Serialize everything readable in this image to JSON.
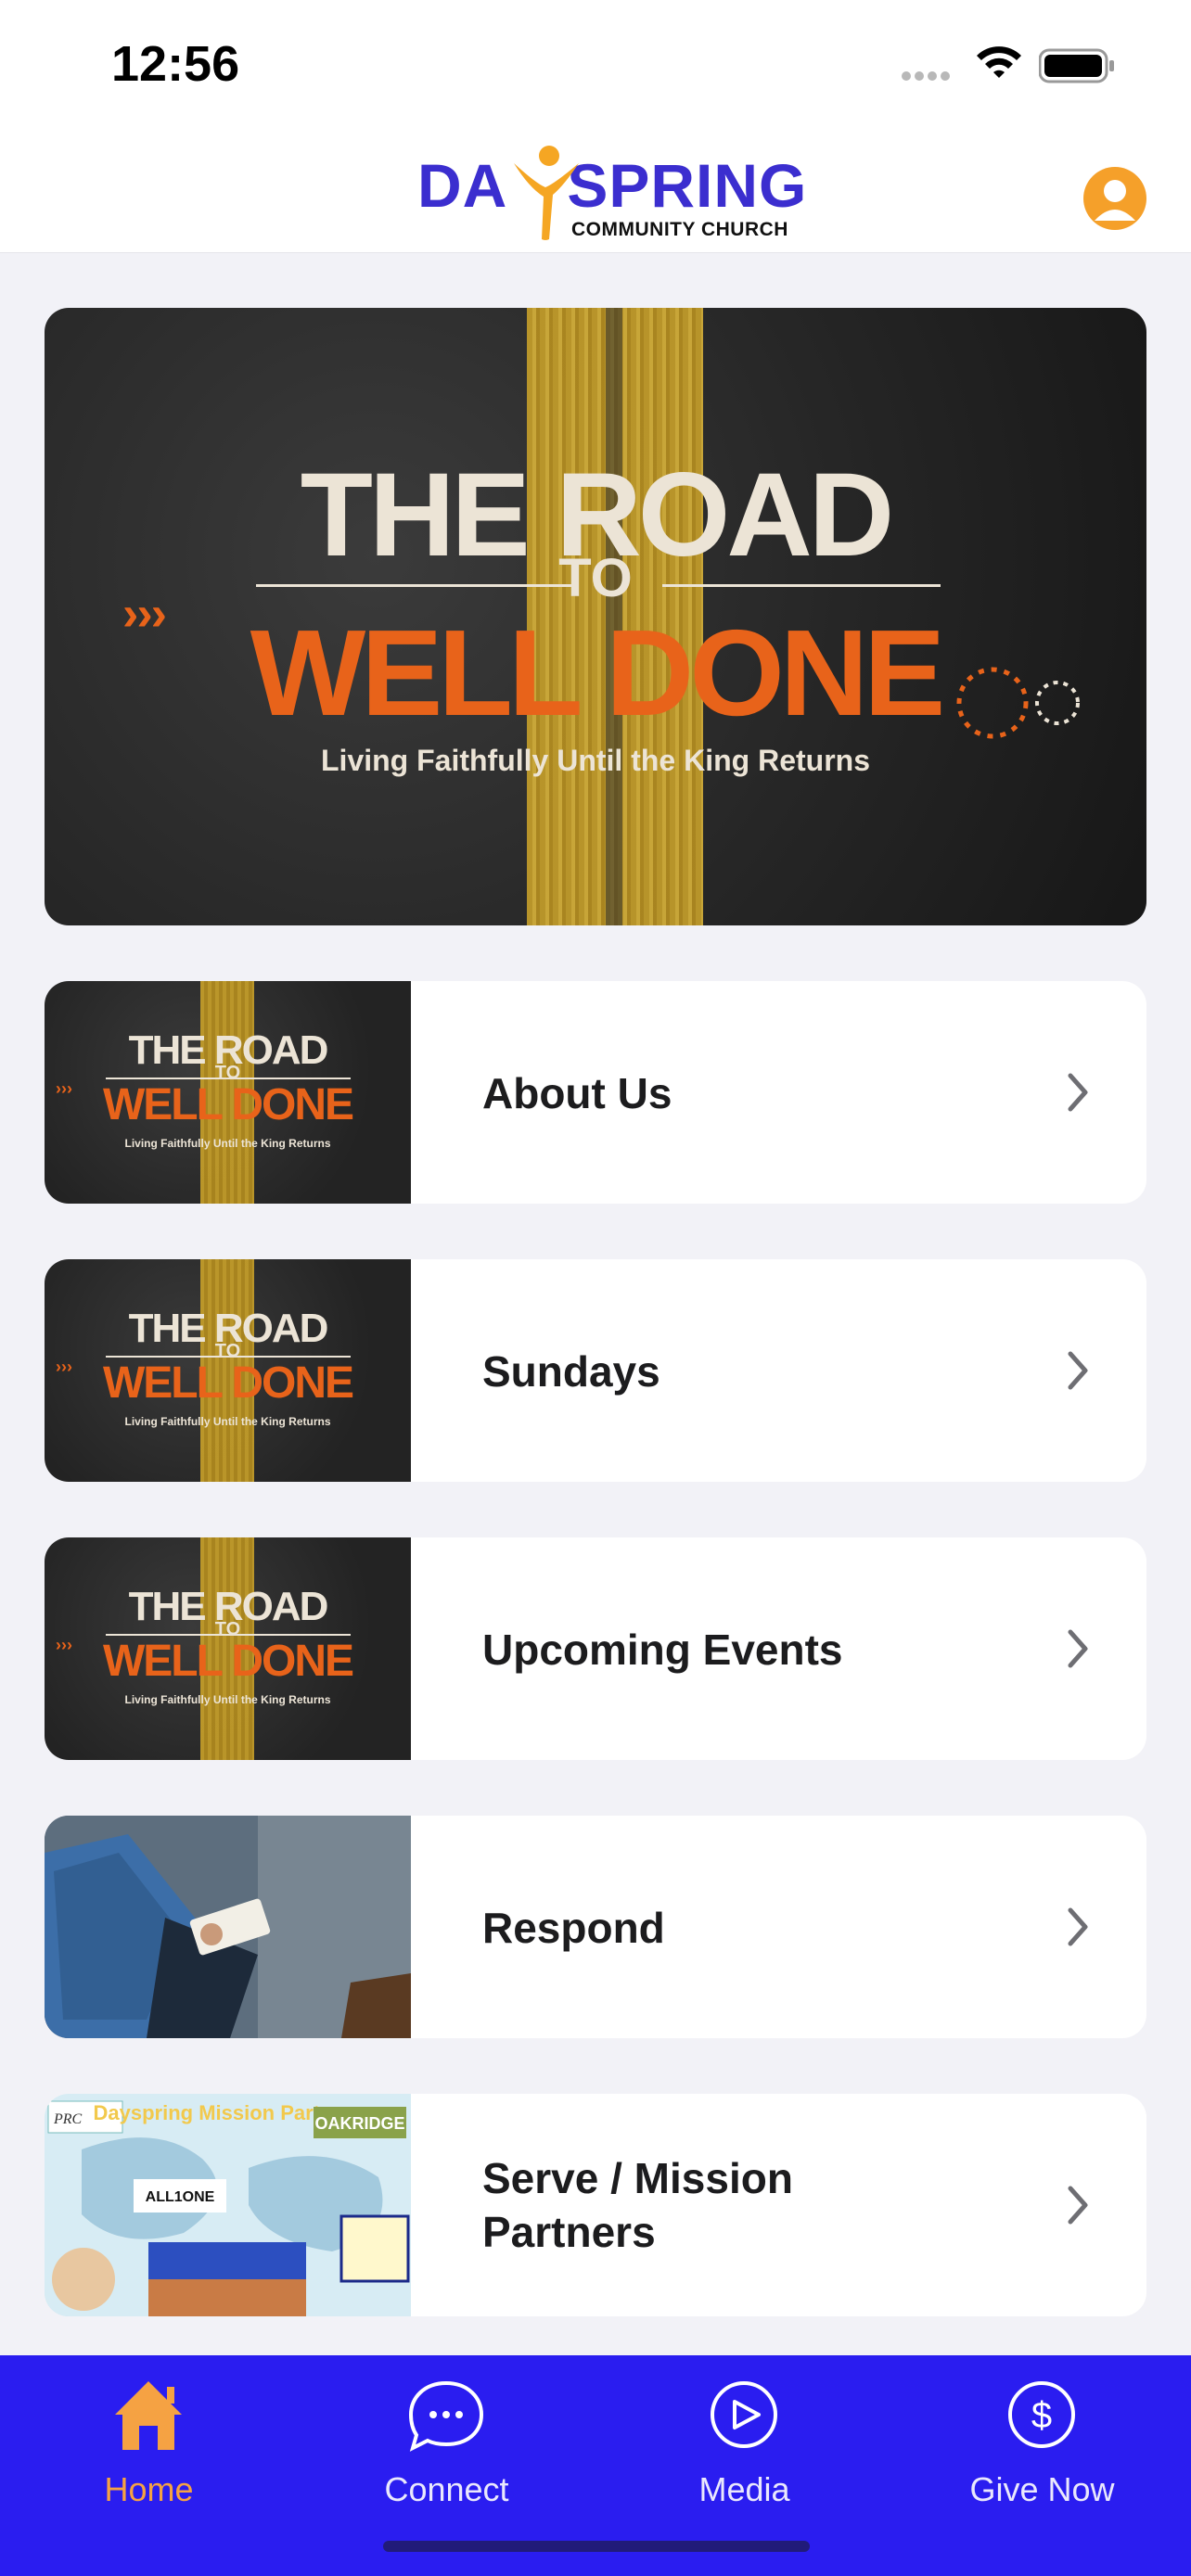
{
  "status_bar": {
    "time": "12:56"
  },
  "header": {
    "logo_text_left": "DA",
    "logo_text_right": "SPRING",
    "logo_subtitle": "COMMUNITY CHURCH"
  },
  "banner": {
    "line1": "THE ROAD",
    "line2": "TO",
    "line3": "WELL DONE",
    "tagline": "Living Faithfully Until the King Returns"
  },
  "thumb_text": {
    "line1": "THE ROAD",
    "line2": "TO",
    "line3": "WELL DONE",
    "tagline": "Living Faithfully Until the King Returns"
  },
  "list": {
    "items": [
      {
        "label": "About Us"
      },
      {
        "label": "Sundays"
      },
      {
        "label": "Upcoming Events"
      },
      {
        "label": "Respond"
      },
      {
        "label": "Serve / Mission Partners"
      }
    ]
  },
  "mission_thumb": {
    "title": "Dayspring Mission Partners",
    "oakridge": "OAKRIDGE",
    "allone": "ALL1ONE"
  },
  "tabbar": {
    "tabs": [
      {
        "label": "Home",
        "icon": "home-icon",
        "active": true
      },
      {
        "label": "Connect",
        "icon": "chat-bubble-icon",
        "active": false
      },
      {
        "label": "Media",
        "icon": "play-circle-icon",
        "active": false
      },
      {
        "label": "Give Now",
        "icon": "dollar-circle-icon",
        "active": false
      }
    ]
  },
  "colors": {
    "brand_blue": "#2a1df0",
    "accent_orange": "#f5a243",
    "logo_blue": "#3b2ecf"
  }
}
